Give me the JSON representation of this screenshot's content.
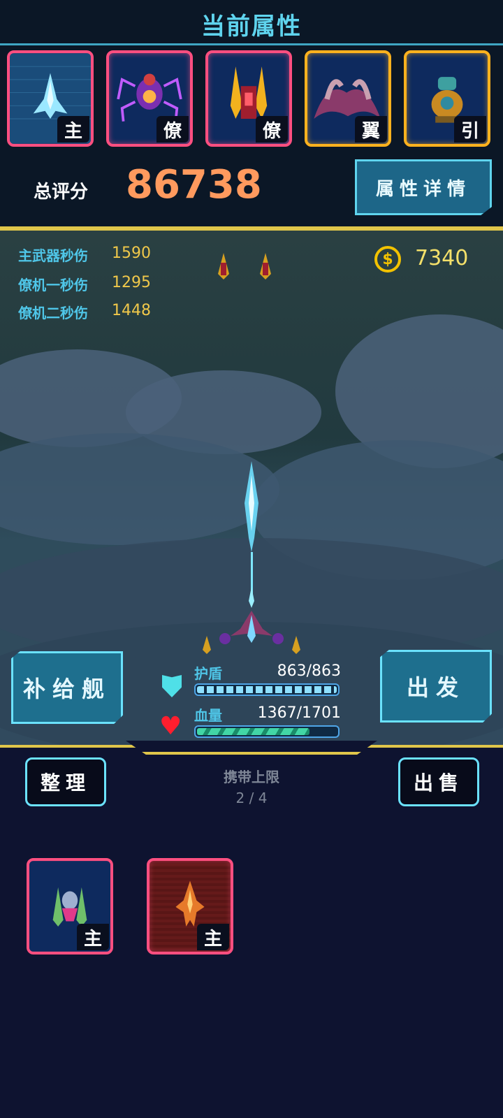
{
  "header": {
    "title": "当前属性"
  },
  "equipped_slots": [
    {
      "tag": "主",
      "name": "main-ship",
      "frame": "red"
    },
    {
      "tag": "僚",
      "name": "wingman-spider",
      "frame": "red"
    },
    {
      "tag": "僚",
      "name": "wingman-twin",
      "frame": "red"
    },
    {
      "tag": "翼",
      "name": "wing",
      "frame": "gold"
    },
    {
      "tag": "引",
      "name": "engine",
      "frame": "gold"
    }
  ],
  "score": {
    "label": "总评分",
    "value": "86738",
    "color": "#ff9a5e"
  },
  "detail_button": {
    "label": "属性详情"
  },
  "stats": [
    {
      "label": "主武器秒伤",
      "value": "1590"
    },
    {
      "label": "僚机一秒伤",
      "value": "1295"
    },
    {
      "label": "僚机二秒伤",
      "value": "1448"
    }
  ],
  "coins": {
    "value": "7340",
    "icon": "coin-icon"
  },
  "supply_button": {
    "label": "补给舰"
  },
  "go_button": {
    "label": "出发"
  },
  "shield": {
    "label": "护盾",
    "value": "863/863",
    "fraction": 1.0
  },
  "hp": {
    "label": "血量",
    "value": "1367/1701",
    "fraction": 0.804
  },
  "inventory": {
    "sort_label": "整理",
    "sell_label": "出售",
    "limit_label": "携带上限",
    "limit_value": "2 / 4",
    "items": [
      {
        "tag": "主"
      },
      {
        "tag": "主"
      }
    ]
  },
  "colors": {
    "accent": "#5fd4ee",
    "gold": "#e0c64a",
    "red_frame": "#ff4f80",
    "gold_frame": "#ffb21e"
  }
}
